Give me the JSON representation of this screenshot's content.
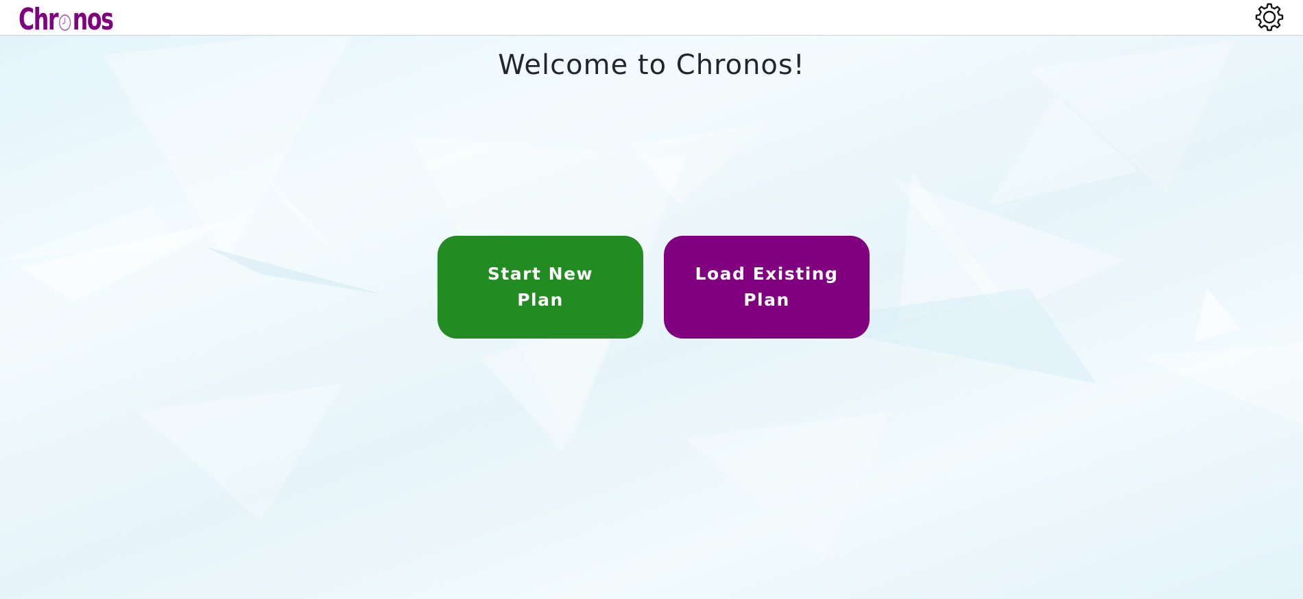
{
  "header": {
    "logo_text_left": "Chr",
    "logo_text_right": "nos",
    "logo_icon": "clock-icon",
    "settings_icon": "gear-icon"
  },
  "main": {
    "welcome_title": "Welcome to Chronos!",
    "start_new_plan_label": "Start New Plan",
    "load_existing_plan_label": "Load Existing Plan"
  },
  "colors": {
    "brand_purple": "#800080",
    "start_button": "#228b22",
    "load_button": "#800080"
  }
}
